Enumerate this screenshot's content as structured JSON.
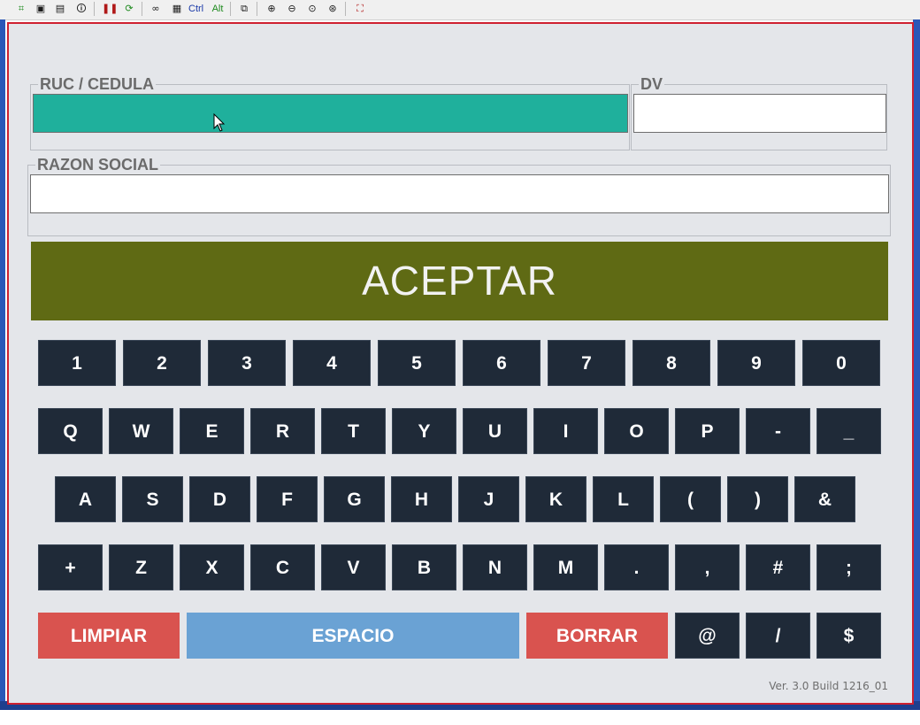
{
  "toolbar": {
    "icons": [
      "tree-icon",
      "save-icon",
      "print-preview-icon",
      "info-icon",
      "pause-icon",
      "refresh-icon",
      "link-icon",
      "keys-icon",
      "ctrl-key",
      "alt-key",
      "copy-icon",
      "zoom-in-icon",
      "zoom-out-icon",
      "zoom-fit-icon",
      "zoom-custom-icon",
      "fullscreen-icon"
    ],
    "ctrl_label": "Ctrl",
    "alt_label": "Alt"
  },
  "form": {
    "ruc_label": "RUC / CEDULA",
    "ruc_value": "",
    "dv_label": "DV",
    "dv_value": "",
    "razon_label": "RAZON SOCIAL",
    "razon_value": ""
  },
  "accept_label": "ACEPTAR",
  "keyboard": {
    "row1": [
      "1",
      "2",
      "3",
      "4",
      "5",
      "6",
      "7",
      "8",
      "9",
      "0"
    ],
    "row2": [
      "Q",
      "W",
      "E",
      "R",
      "T",
      "Y",
      "U",
      "I",
      "O",
      "P",
      "-",
      "_"
    ],
    "row3": [
      "A",
      "S",
      "D",
      "F",
      "G",
      "H",
      "J",
      "K",
      "L",
      "(",
      ")",
      "&"
    ],
    "row4": [
      "+",
      "Z",
      "X",
      "C",
      "V",
      "B",
      "N",
      "M",
      ".",
      ",",
      "#",
      ";"
    ],
    "row5": {
      "limpiar": "LIMPIAR",
      "espacio": "ESPACIO",
      "borrar": "BORRAR",
      "extras": [
        "@",
        "/",
        "$"
      ]
    }
  },
  "colors": {
    "active_field": "#1fb09c",
    "accept_bg": "#5f6a14",
    "key_bg": "#1f2a38",
    "danger": "#d9534f",
    "space": "#6aa2d4",
    "frame_border": "#cf2030"
  },
  "version": "Ver. 3.0 Build 1216_01"
}
